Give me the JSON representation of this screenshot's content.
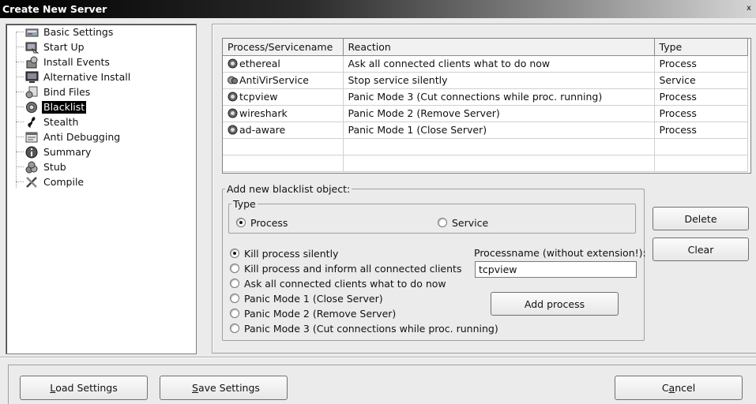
{
  "window": {
    "title": "Create New Server",
    "close_glyph": "x"
  },
  "tree": {
    "items": [
      {
        "label": "Basic Settings",
        "icon": "settings-icon"
      },
      {
        "label": "Start Up",
        "icon": "startup-icon"
      },
      {
        "label": "Install Events",
        "icon": "install-events-icon"
      },
      {
        "label": "Alternative Install",
        "icon": "monitor-icon"
      },
      {
        "label": "Bind Files",
        "icon": "bind-files-icon"
      },
      {
        "label": "Blacklist",
        "icon": "blacklist-icon",
        "selected": true
      },
      {
        "label": "Stealth",
        "icon": "stealth-icon"
      },
      {
        "label": "Anti Debugging",
        "icon": "anti-debugging-icon"
      },
      {
        "label": "Summary",
        "icon": "info-icon"
      },
      {
        "label": "Stub",
        "icon": "stub-icon"
      },
      {
        "label": "Compile",
        "icon": "compile-icon"
      }
    ]
  },
  "grid": {
    "columns": [
      "Process/Servicename",
      "Reaction",
      "Type"
    ],
    "rows": [
      {
        "name": "ethereal",
        "reaction": "Ask all connected clients what to do now",
        "type": "Process"
      },
      {
        "name": "AntiVirService",
        "reaction": "Stop service silently",
        "type": "Service"
      },
      {
        "name": "tcpview",
        "reaction": "Panic Mode 3 (Cut connections while proc. running)",
        "type": "Process"
      },
      {
        "name": "wireshark",
        "reaction": "Panic Mode 2 (Remove Server)",
        "type": "Process"
      },
      {
        "name": "ad-aware",
        "reaction": "Panic Mode 1 (Close Server)",
        "type": "Process"
      }
    ]
  },
  "add_group": {
    "legend": "Add new blacklist object:",
    "type_legend": "Type",
    "type_process": "Process",
    "type_service": "Service",
    "selected_type": "Process",
    "reactions": [
      {
        "label": "Kill process silently",
        "selected": true
      },
      {
        "label": "Kill process and inform all connected clients",
        "selected": false
      },
      {
        "label": "Ask all connected clients what to do now",
        "selected": false
      },
      {
        "label": "Panic Mode 1 (Close Server)",
        "selected": false
      },
      {
        "label": "Panic Mode 2 (Remove Server)",
        "selected": false
      },
      {
        "label": "Panic Mode 3 (Cut connections while proc. running)",
        "selected": false
      }
    ],
    "processname_label": "Processname (without extension!):",
    "processname_value": "tcpview",
    "add_button": "Add process"
  },
  "side_buttons": {
    "delete": "Delete",
    "clear": "Clear"
  },
  "bottom": {
    "load_key": "L",
    "load_rest": "oad Settings",
    "save_key": "S",
    "save_rest": "ave Settings",
    "cancel_pre": "C",
    "cancel_key": "a",
    "cancel_rest": "ncel"
  }
}
